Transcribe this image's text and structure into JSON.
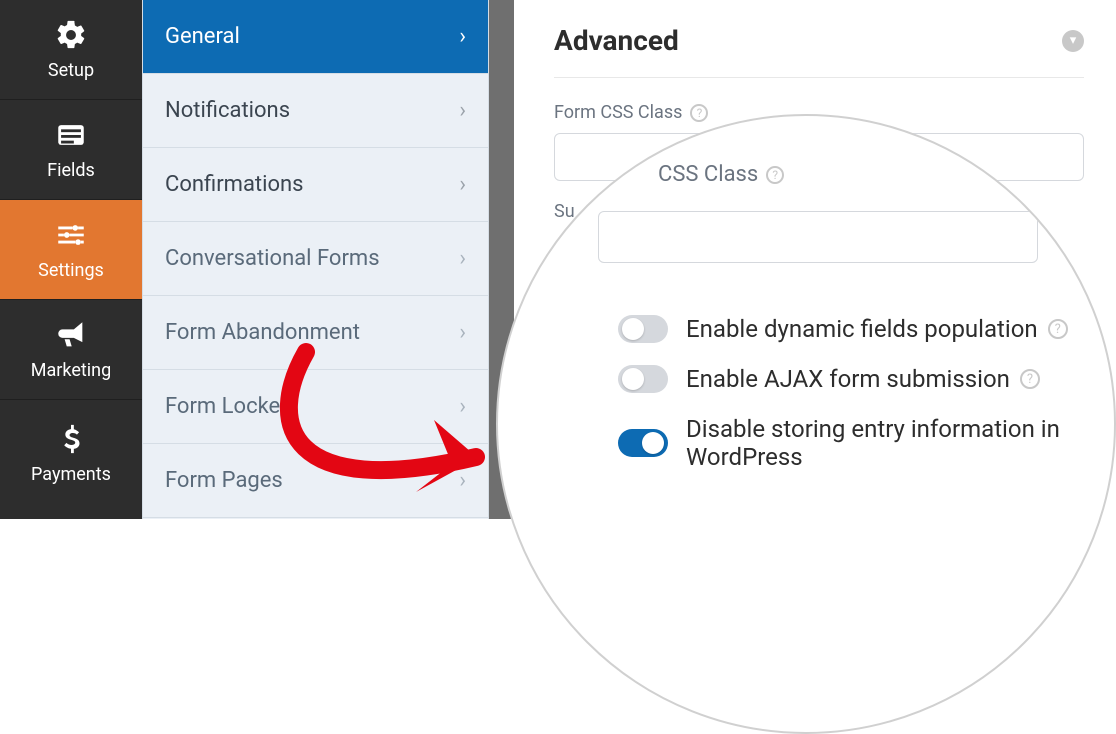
{
  "nav": {
    "items": [
      {
        "label": "Setup"
      },
      {
        "label": "Fields"
      },
      {
        "label": "Settings"
      },
      {
        "label": "Marketing"
      },
      {
        "label": "Payments"
      }
    ]
  },
  "settings": {
    "items": [
      {
        "label": "General",
        "active": true
      },
      {
        "label": "Notifications"
      },
      {
        "label": "Confirmations"
      },
      {
        "label": "Conversational Forms"
      },
      {
        "label": "Form Abandonment"
      },
      {
        "label": "Form Locker"
      },
      {
        "label": "Form Pages"
      }
    ]
  },
  "main": {
    "section_title": "Advanced",
    "form_css_label": "Form CSS Class",
    "submit_label_partial": "Su",
    "zoom_css_label": "CSS Class",
    "toggles": {
      "dynamic": "Enable dynamic fields population",
      "ajax": "Enable AJAX form submission",
      "disable_store": "Disable storing entry information in WordPress"
    }
  }
}
